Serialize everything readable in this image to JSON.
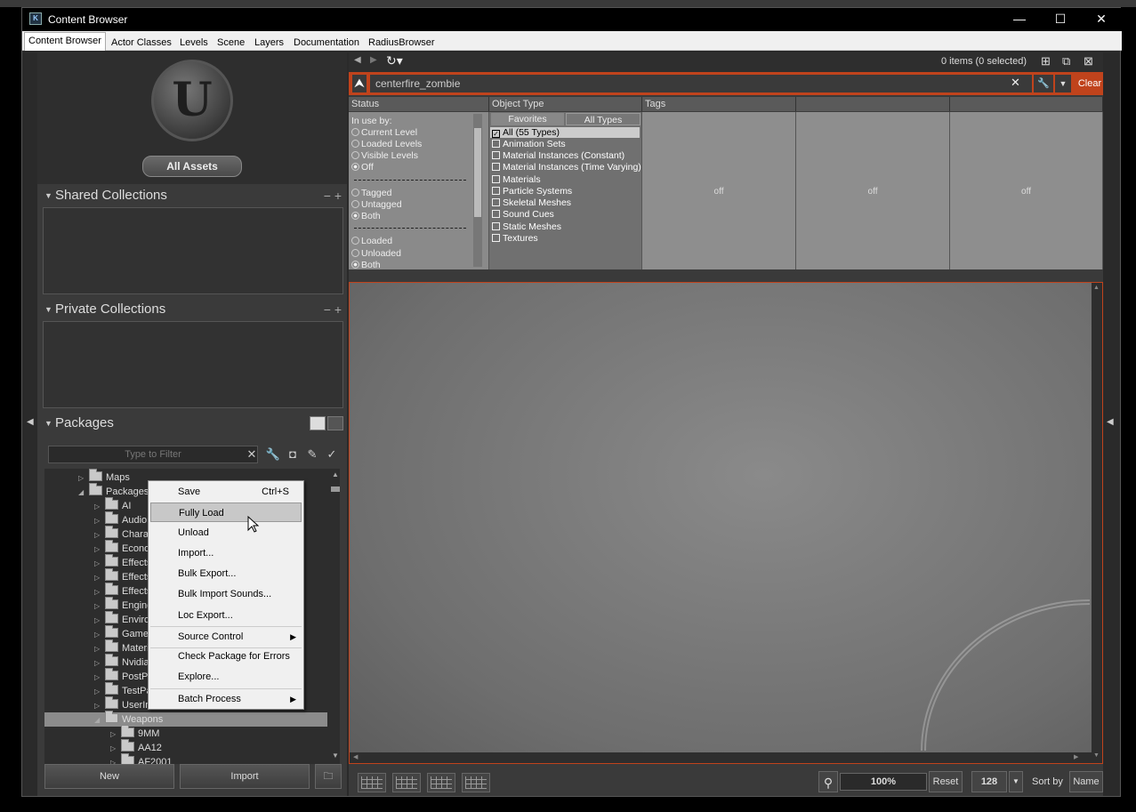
{
  "window": {
    "title": "Content Browser",
    "min": "—",
    "max": "☐",
    "close": "✕"
  },
  "tabs": [
    "Content Browser",
    "Actor Classes",
    "Levels",
    "Scene",
    "Layers",
    "Documentation",
    "RadiusBrowser"
  ],
  "left": {
    "all_assets": "All Assets",
    "shared_collections": "Shared Collections",
    "private_collections": "Private Collections",
    "packages": "Packages",
    "filter_placeholder": "Type to Filter",
    "tree": [
      {
        "label": "Maps"
      },
      {
        "label": "Packages"
      },
      {
        "label": "AI"
      },
      {
        "label": "Audio"
      },
      {
        "label": "Characters"
      },
      {
        "label": "Economy"
      },
      {
        "label": "Effects"
      },
      {
        "label": "EffectsThree"
      },
      {
        "label": "Effects_AMI"
      },
      {
        "label": "EngineExtensions"
      },
      {
        "label": "Environment"
      },
      {
        "label": "Gameplay"
      },
      {
        "label": "MaterialLib"
      },
      {
        "label": "Nvidia"
      },
      {
        "label": "PostProcessing"
      },
      {
        "label": "TestPackages"
      },
      {
        "label": "UserInterface"
      },
      {
        "label": "Weapons"
      },
      {
        "label": "9MM"
      },
      {
        "label": "AA12"
      },
      {
        "label": "AF2001"
      }
    ],
    "new_button": "New",
    "import_button": "Import"
  },
  "right": {
    "items_selected": "0 items (0 selected)",
    "search_value": "centerfire_zombie",
    "clear_label": "Clear",
    "status_header": "Status",
    "object_type_header": "Object Type",
    "tags_header": "Tags",
    "status": {
      "in_use_by": "In use by:",
      "options": [
        "Current Level",
        "Loaded Levels",
        "Visible Levels",
        "Off"
      ],
      "tag_options": [
        "Tagged",
        "Untagged",
        "Both"
      ],
      "load_options": [
        "Loaded",
        "Unloaded",
        "Both"
      ]
    },
    "type_tabs": [
      "Favorites",
      "All Types"
    ],
    "types": [
      "All (55 Types)",
      "Animation Sets",
      "Material Instances (Constant)",
      "Material Instances (Time Varying)",
      "Materials",
      "Particle Systems",
      "Skeletal Meshes",
      "Sound Cues",
      "Static Meshes",
      "Textures"
    ],
    "tag_col_1": "off",
    "tag_col_2": "off",
    "tag_col_3": "off",
    "zoom": "100%",
    "reset": "Reset",
    "thumb_size": "128",
    "sort_by": "Sort by",
    "sort_value": "Name"
  },
  "context_menu": {
    "items": [
      {
        "label": "Save",
        "shortcut": "Ctrl+S"
      },
      {
        "label": "Fully Load"
      },
      {
        "label": "Unload"
      },
      {
        "label": "Import..."
      },
      {
        "label": "Bulk Export..."
      },
      {
        "label": "Bulk Import Sounds..."
      },
      {
        "label": "Loc Export..."
      },
      {
        "label": "Source Control"
      },
      {
        "label": "Check Package for Errors"
      },
      {
        "label": "Explore..."
      },
      {
        "label": "Batch Process"
      }
    ]
  },
  "colors": {
    "accent": "#c0431c",
    "panel": "#3a3a3a"
  }
}
